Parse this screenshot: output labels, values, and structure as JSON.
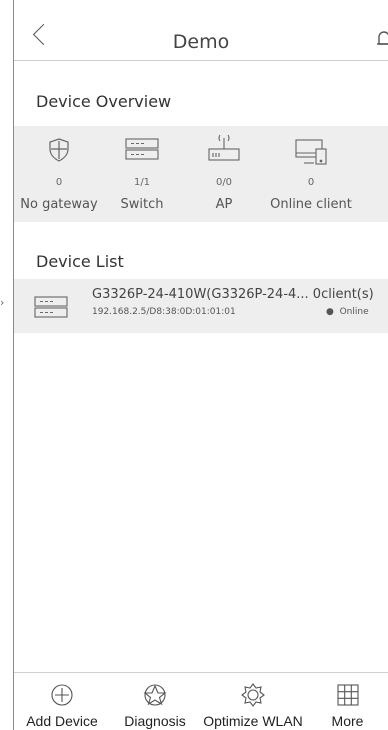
{
  "header": {
    "title": "Demo"
  },
  "overview": {
    "title": "Device Overview",
    "items": [
      {
        "icon": "shield-icon",
        "count": "0",
        "label": "No gateway"
      },
      {
        "icon": "switch-icon",
        "count": "1/1",
        "label": "Switch"
      },
      {
        "icon": "router-icon",
        "count": "0/0",
        "label": "AP"
      },
      {
        "icon": "client-icon",
        "count": "0",
        "label": "Online client"
      }
    ]
  },
  "device_list": {
    "title": "Device List",
    "devices": [
      {
        "name": "G3326P-24-410W(G3326P-24-4... 0client(s)",
        "address": "192.168.2.5/D8:38:0D:01:01:01",
        "status": "Online"
      }
    ]
  },
  "tabbar": {
    "tabs": [
      {
        "icon": "add-icon",
        "label": "Add Device"
      },
      {
        "icon": "diagnosis-icon",
        "label": "Diagnosis"
      },
      {
        "icon": "optimize-icon",
        "label": "Optimize WLAN"
      },
      {
        "icon": "grid-icon",
        "label": "More"
      }
    ]
  }
}
